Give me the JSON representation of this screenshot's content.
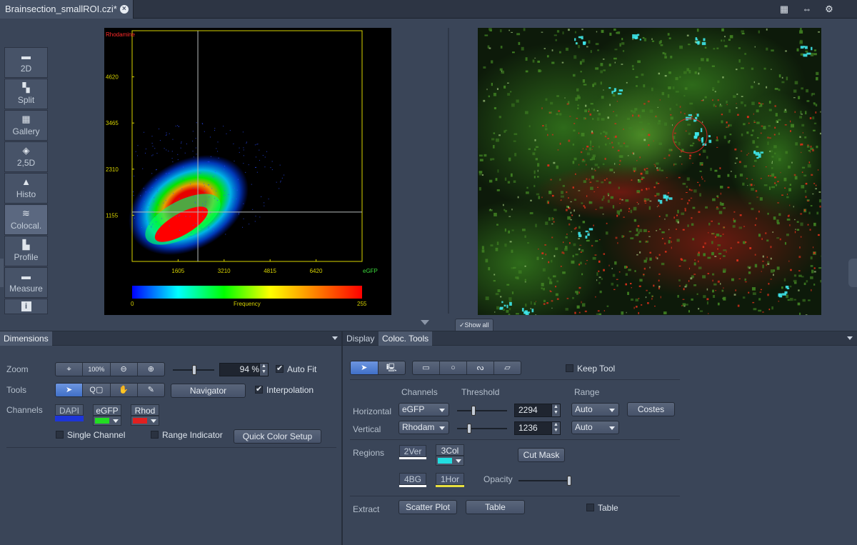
{
  "document_tab": {
    "title": "Brainsection_smallROI.czi*"
  },
  "view_modes": [
    {
      "label": "2D"
    },
    {
      "label": "Split"
    },
    {
      "label": "Gallery"
    },
    {
      "label": "2,5D"
    },
    {
      "label": "Histo"
    },
    {
      "label": "Colocal."
    },
    {
      "label": "Profile"
    },
    {
      "label": "Measure"
    },
    {
      "label": "i"
    }
  ],
  "active_view_mode": "Colocal.",
  "chart_data": {
    "type": "heatmap",
    "title": "",
    "ylabel": "Rhodamine",
    "xlabel": "eGFP",
    "x_ticks": [
      "1605",
      "3210",
      "4815",
      "6420"
    ],
    "y_ticks": [
      "4620",
      "3465",
      "2310",
      "1155"
    ],
    "xlim": [
      0,
      8025
    ],
    "ylim": [
      0,
      5775
    ],
    "thresholds": {
      "x": 2294,
      "y": 1236
    },
    "colorbar": {
      "label": "Frequency",
      "min": "0",
      "max": "255",
      "colors": [
        "#0000ff",
        "#00ffff",
        "#00ff00",
        "#ffff00",
        "#ff8000",
        "#ff0000"
      ]
    },
    "axis_color": "#d8d400",
    "ylabel_color": "#ff2a2a",
    "xlabel_color": "#3cdc3c"
  },
  "show_all": {
    "label": "Show all"
  },
  "dimensions": {
    "tab_label": "Dimensions",
    "zoom_label": "Zoom",
    "zoom_100": "100%",
    "zoom_value": "94 %",
    "auto_fit_label": "Auto Fit",
    "auto_fit_checked": true,
    "tools_label": "Tools",
    "navigator_label": "Navigator",
    "interpolation_label": "Interpolation",
    "interpolation_checked": true,
    "channels_label": "Channels",
    "channels": [
      {
        "name": "DAPI",
        "color": "#1d35d8"
      },
      {
        "name": "eGFP",
        "color": "#22dd22"
      },
      {
        "name": "Rhod",
        "color": "#e02020"
      }
    ],
    "single_channel_label": "Single Channel",
    "range_indicator_label": "Range Indicator",
    "quick_color_label": "Quick Color Setup"
  },
  "coloc": {
    "tabs": [
      "Display",
      "Coloc. Tools"
    ],
    "active_tab": "Coloc. Tools",
    "keep_tool_label": "Keep Tool",
    "col_channels": "Channels",
    "col_threshold": "Threshold",
    "col_range": "Range",
    "horizontal": {
      "label": "Horizontal",
      "channel": "eGFP",
      "threshold": "2294",
      "range": "Auto"
    },
    "vertical": {
      "label": "Vertical",
      "channel": "Rhodam",
      "threshold": "1236",
      "range": "Auto"
    },
    "costes_label": "Costes",
    "regions_label": "Regions",
    "regions": [
      {
        "name": "2Ver",
        "color": "#ffffff"
      },
      {
        "name": "3Col",
        "color": "#22dde0"
      },
      {
        "name": "4BG",
        "color": "#ffffff"
      },
      {
        "name": "1Hor",
        "color": "#e8e040"
      }
    ],
    "cut_mask_label": "Cut Mask",
    "opacity_label": "Opacity",
    "extract_label": "Extract",
    "scatter_plot_label": "Scatter Plot",
    "table_button_label": "Table",
    "table_check_label": "Table"
  }
}
